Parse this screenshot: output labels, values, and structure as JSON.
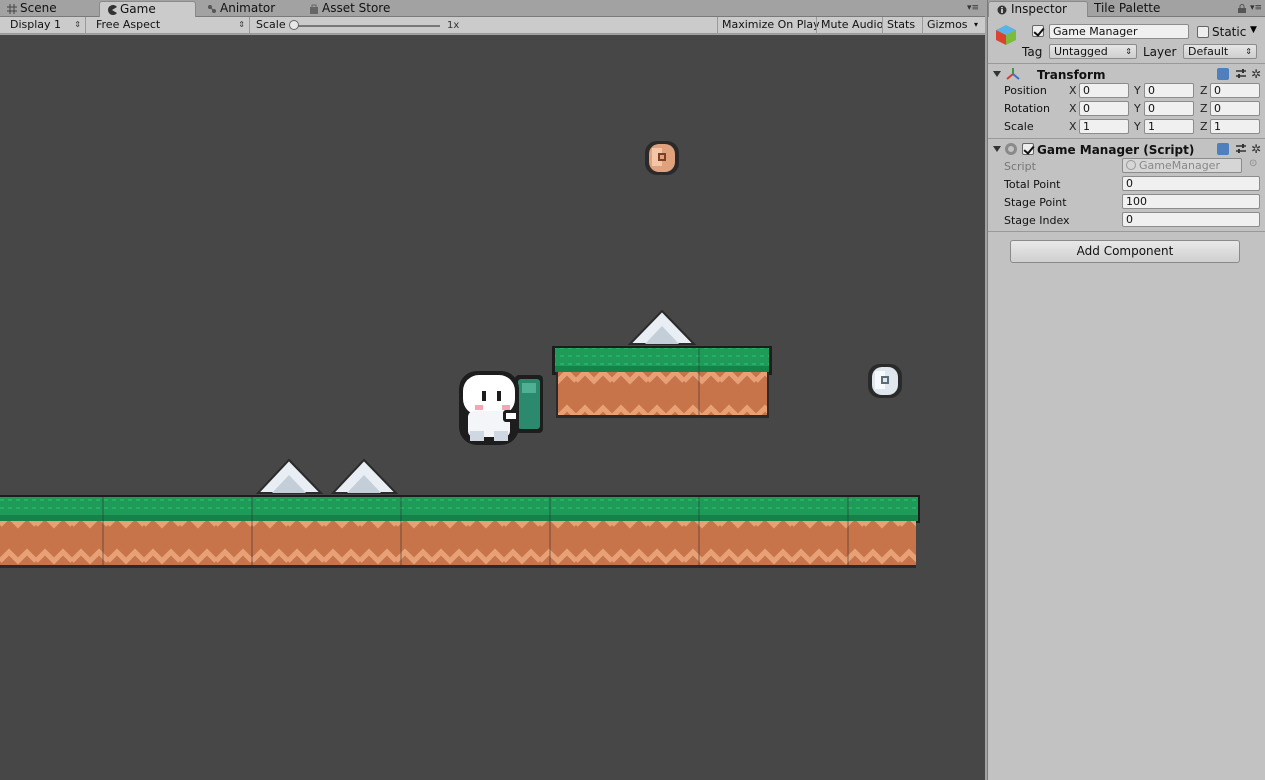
{
  "game_panel": {
    "tabs": [
      {
        "label": "Scene",
        "icon": "grid-icon"
      },
      {
        "label": "Game",
        "icon": "pacman-icon"
      },
      {
        "label": "Animator",
        "icon": "animator-icon"
      },
      {
        "label": "Asset Store",
        "icon": "bag-icon"
      }
    ],
    "toolbar": {
      "display": "Display 1",
      "aspect": "Free Aspect",
      "scale_label": "Scale",
      "scale_value": "1x",
      "maximize_on_play": "Maximize On Play",
      "mute_audio": "Mute Audio",
      "stats": "Stats",
      "gizmos": "Gizmos"
    }
  },
  "inspector": {
    "tabs": [
      {
        "label": "Inspector",
        "icon": "info-icon"
      },
      {
        "label": "Tile Palette",
        "icon": ""
      }
    ],
    "object": {
      "name": "Game Manager",
      "active": true,
      "static_label": "Static",
      "static": false,
      "tag_label": "Tag",
      "tag_value": "Untagged",
      "layer_label": "Layer",
      "layer_value": "Default"
    },
    "transform": {
      "header": "Transform",
      "rows": [
        {
          "label": "Position",
          "x": "0",
          "y": "0",
          "z": "0"
        },
        {
          "label": "Rotation",
          "x": "0",
          "y": "0",
          "z": "0"
        },
        {
          "label": "Scale",
          "x": "1",
          "y": "1",
          "z": "1"
        }
      ],
      "axes": [
        "X",
        "Y",
        "Z"
      ]
    },
    "script_component": {
      "header": "Game Manager (Script)",
      "enabled": true,
      "script_label": "Script",
      "script_value": "GameManager",
      "fields": [
        {
          "label": "Total Point",
          "value": "0"
        },
        {
          "label": "Stage Point",
          "value": "100"
        },
        {
          "label": "Stage Index",
          "value": "0"
        }
      ]
    },
    "add_component": "Add Component"
  },
  "colors": {
    "viewport_bg": "#474747",
    "grass": "#1f9a5a",
    "dirt": "#c8744a",
    "editor_gray": "#c2c2c2"
  }
}
